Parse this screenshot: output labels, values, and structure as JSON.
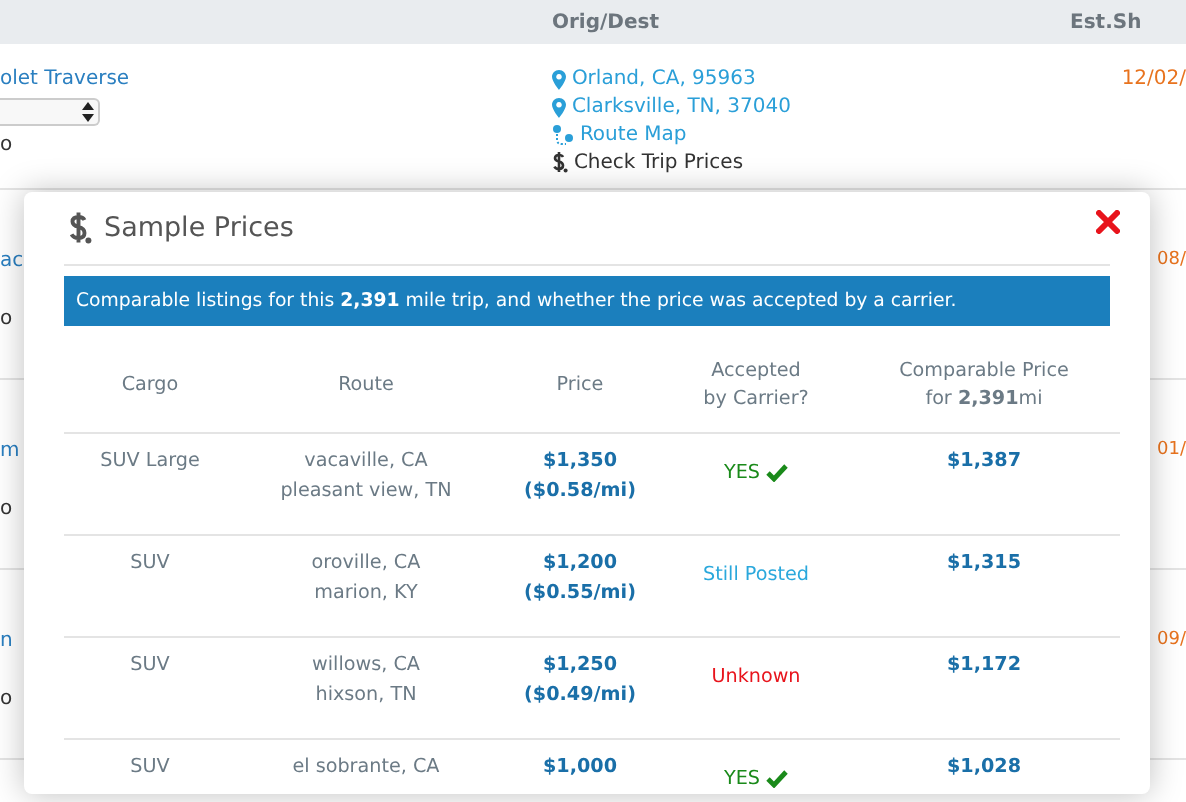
{
  "background": {
    "header": [
      "Orig/Dest",
      "Est.Sh"
    ],
    "rows": [
      {
        "title": "olet Traverse",
        "has_select": true,
        "subtitle": "o",
        "origin": "Orland, CA, 95963",
        "destination": "Clarksville, TN, 37040",
        "route_map": "Route Map",
        "check_prices": "Check Trip Prices",
        "date": "12/02/"
      },
      {
        "title": "ac",
        "subtitle": "o",
        "date": "08/"
      },
      {
        "title": "m",
        "subtitle": "o",
        "date": "01/"
      },
      {
        "title": "n",
        "subtitle": "o",
        "date": "09/"
      }
    ]
  },
  "modal": {
    "title": "Sample Prices",
    "banner": "Comparable listings for this **2,391** mile trip, and whether the price was accepted by a carrier.",
    "columns": [
      [
        "Cargo"
      ],
      [
        "Route"
      ],
      [
        "Price"
      ],
      [
        "Accepted",
        "by Carrier?"
      ],
      [
        "Comparable Price",
        "for **2,391**mi"
      ]
    ],
    "rows": [
      {
        "cargo": "SUV Large",
        "route": [
          "vacaville, CA",
          "pleasant view, TN"
        ],
        "price": "$1,350",
        "per_mile": "($0.58/mi)",
        "status": "YES",
        "kind": "yes",
        "comparable": "$1,387"
      },
      {
        "cargo": "SUV",
        "route": [
          "oroville, CA",
          "marion, KY"
        ],
        "price": "$1,200",
        "per_mile": "($0.55/mi)",
        "status": "Still Posted",
        "kind": "posted",
        "comparable": "$1,315"
      },
      {
        "cargo": "SUV",
        "route": [
          "willows, CA",
          "hixson, TN"
        ],
        "price": "$1,250",
        "per_mile": "($0.49/mi)",
        "status": "Unknown",
        "kind": "unknown",
        "comparable": "$1,172"
      },
      {
        "cargo": "SUV",
        "route": [
          "el sobrante, CA"
        ],
        "price": "$1,000",
        "status": "YES",
        "kind": "yes",
        "comparable": "$1,028"
      }
    ]
  }
}
